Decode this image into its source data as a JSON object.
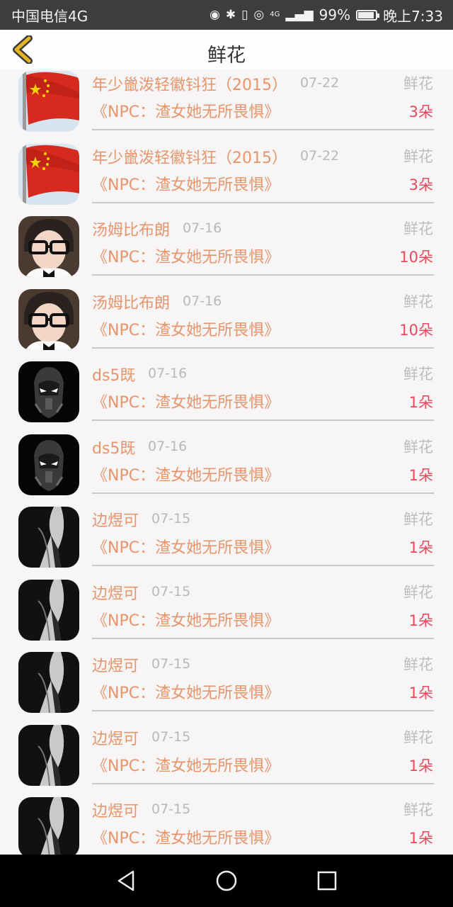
{
  "status": {
    "carrier": "中国电信4G",
    "network": "4G",
    "battery": "99%",
    "battery_level": 0.99,
    "time": "晚上7:33"
  },
  "header": {
    "title": "鲜花",
    "back_icon": "chevron-left-icon"
  },
  "list": [
    {
      "name": "年少巤泼轻徽钭狂（2015）",
      "date": "07-22",
      "gift_type": "鲜花",
      "book": "《NPC：渣女她无所畏惧》",
      "count": "3朵",
      "avatar": "flag-avatar"
    },
    {
      "name": "年少巤泼轻徽钭狂（2015）",
      "date": "07-22",
      "gift_type": "鲜花",
      "book": "《NPC：渣女她无所畏惧》",
      "count": "3朵",
      "avatar": "flag-avatar"
    },
    {
      "name": "汤姆比布朗",
      "date": "07-16",
      "gift_type": "鲜花",
      "book": "《NPC：渣女她无所畏惧》",
      "count": "10朵",
      "avatar": "glasses-avatar"
    },
    {
      "name": "汤姆比布朗",
      "date": "07-16",
      "gift_type": "鲜花",
      "book": "《NPC：渣女她无所畏惧》",
      "count": "10朵",
      "avatar": "glasses-avatar"
    },
    {
      "name": "ds5既",
      "date": "07-16",
      "gift_type": "鲜花",
      "book": "《NPC：渣女她无所畏惧》",
      "count": "1朵",
      "avatar": "robot-avatar"
    },
    {
      "name": "ds5既",
      "date": "07-16",
      "gift_type": "鲜花",
      "book": "《NPC：渣女她无所畏惧》",
      "count": "1朵",
      "avatar": "robot-avatar"
    },
    {
      "name": "边煜可",
      "date": "07-15",
      "gift_type": "鲜花",
      "book": "《NPC：渣女她无所畏惧》",
      "count": "1朵",
      "avatar": "suit-avatar"
    },
    {
      "name": "边煜可",
      "date": "07-15",
      "gift_type": "鲜花",
      "book": "《NPC：渣女她无所畏惧》",
      "count": "1朵",
      "avatar": "suit-avatar"
    },
    {
      "name": "边煜可",
      "date": "07-15",
      "gift_type": "鲜花",
      "book": "《NPC：渣女她无所畏惧》",
      "count": "1朵",
      "avatar": "suit-avatar"
    },
    {
      "name": "边煜可",
      "date": "07-15",
      "gift_type": "鲜花",
      "book": "《NPC：渣女她无所畏惧》",
      "count": "1朵",
      "avatar": "suit-avatar"
    },
    {
      "name": "边煜可",
      "date": "07-15",
      "gift_type": "鲜花",
      "book": "《NPC：渣女她无所畏惧》",
      "count": "1朵",
      "avatar": "suit-avatar"
    }
  ],
  "navbar": {
    "back_icon": "triangle-back-icon",
    "home_icon": "circle-home-icon",
    "recent_icon": "square-recent-icon"
  },
  "colors": {
    "name": "#e8956c",
    "count": "#e8495c",
    "date": "#b9b9b9",
    "back_chevron": "#e6b325"
  }
}
